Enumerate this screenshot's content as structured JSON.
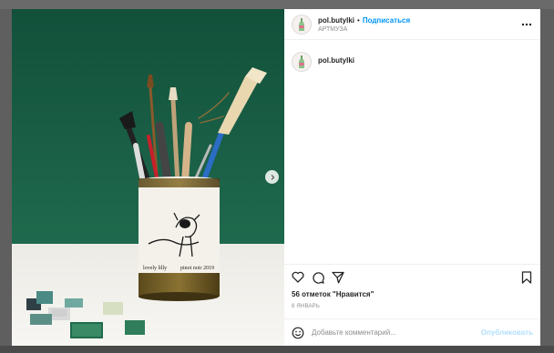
{
  "post": {
    "username": "pol.butylki",
    "separator": "•",
    "follow_label": "Подписаться",
    "location": "АРТМУЗА",
    "caption_username": "pol.butylki",
    "likes_text": "56 отметок \"Нравится\"",
    "date_text": "8 ЯНВАРЬ"
  },
  "photo": {
    "jar_label_left": "lovely lilly",
    "jar_label_right": "pinot noir 2019"
  },
  "comment": {
    "placeholder": "Добавьте комментарий...",
    "publish_label": "Опубликовать"
  },
  "icons": {
    "more": "more-dots-icon",
    "like": "heart-icon",
    "comment": "comment-bubble-icon",
    "share": "paper-plane-icon",
    "save": "bookmark-icon",
    "emoji": "smiley-icon",
    "next": "chevron-right-icon",
    "avatar": "bottle-logo-icon"
  },
  "colors": {
    "follow": "#0095f6",
    "publish_disabled": "#b2dffc",
    "wall": "#1f5c47"
  }
}
